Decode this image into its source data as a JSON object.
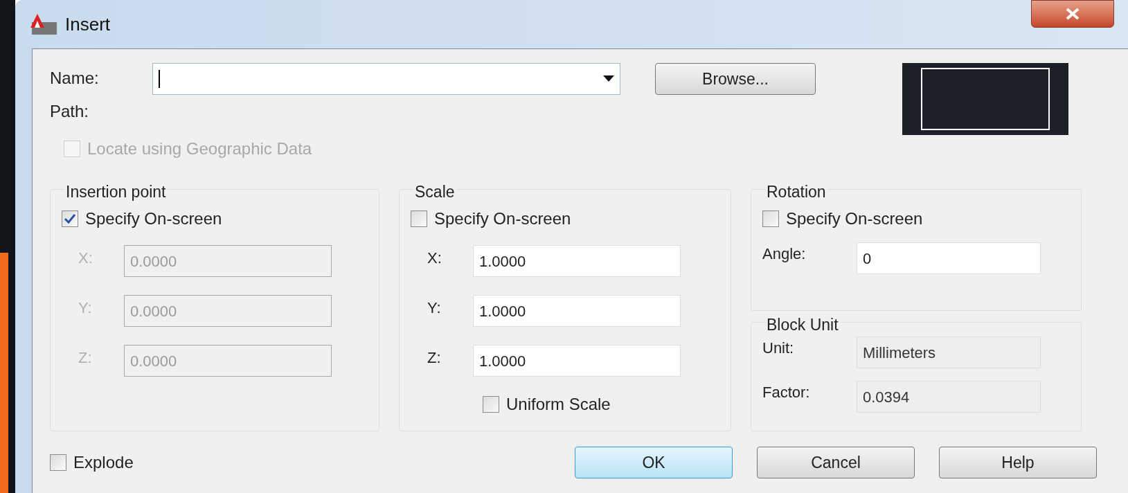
{
  "window": {
    "title": "Insert"
  },
  "name_field": {
    "label": "Name:"
  },
  "browse_button": {
    "label": "Browse..."
  },
  "path": {
    "label": "Path:"
  },
  "locate": {
    "label": "Locate using Geographic Data",
    "checked": false,
    "disabled": true
  },
  "insertion_point": {
    "title": "Insertion point",
    "specify": {
      "label": "Specify On-screen",
      "checked": true
    },
    "fields": [
      {
        "label": "X:",
        "value": "0.0000",
        "disabled": true
      },
      {
        "label": "Y:",
        "value": "0.0000",
        "disabled": true
      },
      {
        "label": "Z:",
        "value": "0.0000",
        "disabled": true
      }
    ]
  },
  "scale": {
    "title": "Scale",
    "specify": {
      "label": "Specify On-screen",
      "checked": false
    },
    "fields": [
      {
        "label": "X:",
        "value": "1.0000",
        "disabled": false
      },
      {
        "label": "Y:",
        "value": "1.0000",
        "disabled": false
      },
      {
        "label": "Z:",
        "value": "1.0000",
        "disabled": false
      }
    ],
    "uniform": {
      "label": "Uniform Scale",
      "checked": false
    }
  },
  "rotation": {
    "title": "Rotation",
    "specify": {
      "label": "Specify On-screen",
      "checked": false
    },
    "angle": {
      "label": "Angle:",
      "value": "0"
    }
  },
  "block_unit": {
    "title": "Block Unit",
    "unit": {
      "label": "Unit:",
      "value": "Millimeters"
    },
    "factor": {
      "label": "Factor:",
      "value": "0.0394"
    }
  },
  "explode": {
    "label": "Explode",
    "checked": false
  },
  "buttons": [
    {
      "label": "OK",
      "default": true
    },
    {
      "label": "Cancel",
      "default": false
    },
    {
      "label": "Help",
      "default": false
    }
  ]
}
